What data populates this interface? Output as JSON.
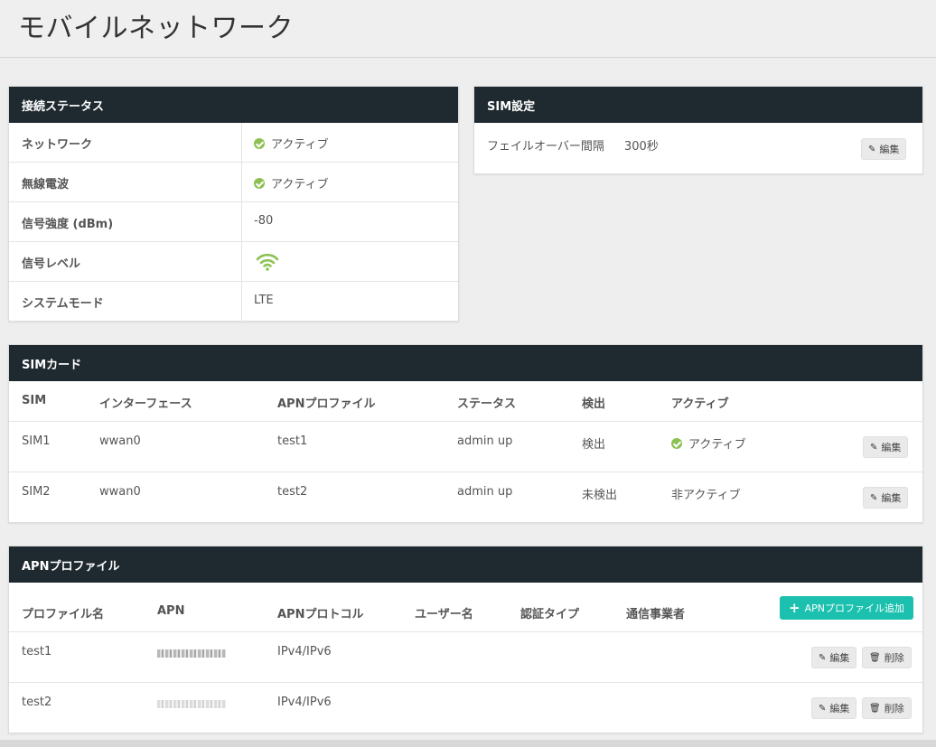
{
  "page": {
    "title": "モバイルネットワーク"
  },
  "status_panel": {
    "title": "接続ステータス",
    "rows": [
      {
        "label": "ネットワーク",
        "value": "アクティブ",
        "icon": "check-circle-icon"
      },
      {
        "label": "無線電波",
        "value": "アクティブ",
        "icon": "check-circle-icon"
      },
      {
        "label": "信号強度 (dBm)",
        "value": "-80"
      },
      {
        "label": "信号レベル",
        "icon": "wifi-signal-icon"
      },
      {
        "label": "システムモード",
        "value": "LTE"
      }
    ]
  },
  "sim_settings": {
    "title": "SIM設定",
    "failover_label": "フェイルオーバー間隔",
    "failover_value": "300秒",
    "edit_label": "編集"
  },
  "sim_cards": {
    "title": "SIMカード",
    "headers": [
      "SIM",
      "インターフェース",
      "APNプロファイル",
      "ステータス",
      "検出",
      "アクティブ"
    ],
    "rows": [
      {
        "sim": "SIM1",
        "iface": "wwan0",
        "apn": "test1",
        "status": "admin up",
        "detect": "検出",
        "active": "アクティブ",
        "active_icon": true
      },
      {
        "sim": "SIM2",
        "iface": "wwan0",
        "apn": "test2",
        "status": "admin up",
        "detect": "未検出",
        "active": "非アクティブ",
        "active_icon": false
      }
    ],
    "edit_label": "編集"
  },
  "apn_profiles": {
    "title": "APNプロファイル",
    "headers": [
      "プロファイル名",
      "APN",
      "APNプロトコル",
      "ユーザー名",
      "認証タイプ",
      "通信事業者"
    ],
    "add_label": "APNプロファイル追加",
    "rows": [
      {
        "name": "test1",
        "protocol": "IPv4/IPv6"
      },
      {
        "name": "test2",
        "protocol": "IPv4/IPv6"
      }
    ],
    "edit_label": "編集",
    "delete_label": "削除"
  },
  "colors": {
    "header_bg": "#1f2a30",
    "ok_green": "#8cc152",
    "add_teal": "#1bc0ae"
  }
}
